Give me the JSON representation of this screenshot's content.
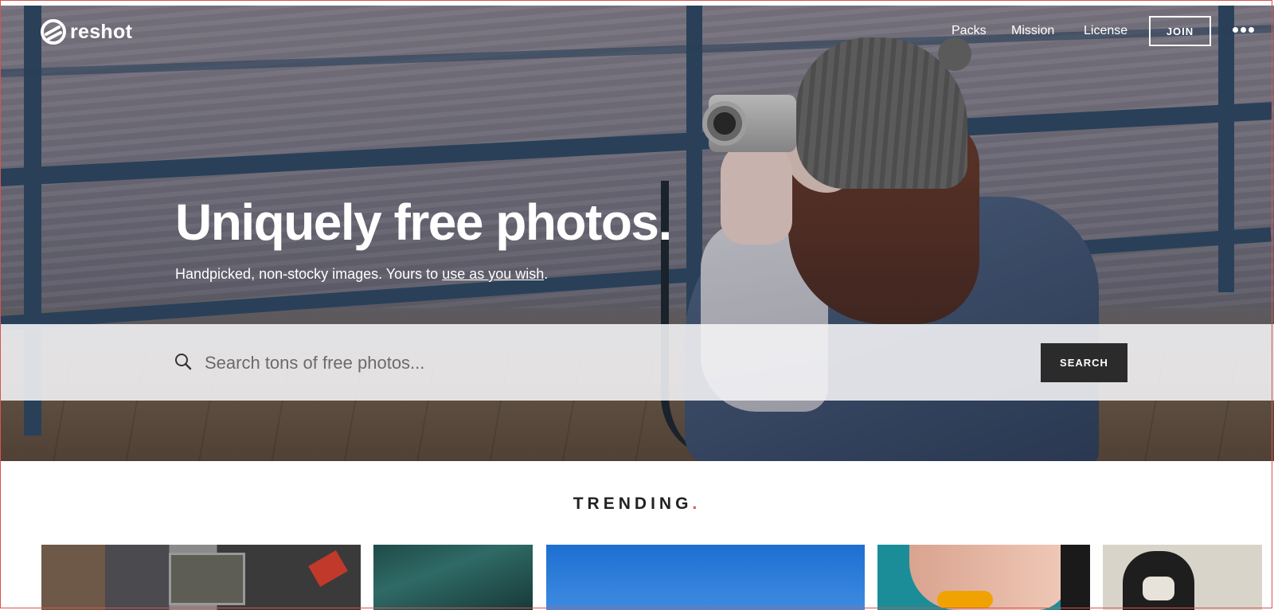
{
  "brand": {
    "name": "reshot"
  },
  "nav": {
    "items": [
      {
        "label": "Packs"
      },
      {
        "label": "Mission"
      },
      {
        "label": "License"
      }
    ],
    "join_label": "JOIN",
    "more_icon": "more-dots-icon"
  },
  "hero": {
    "headline": "Uniquely free photos.",
    "subline_prefix": "Handpicked, non-stocky images. Yours to ",
    "subline_link": "use as you wish",
    "subline_suffix": "."
  },
  "search": {
    "placeholder": "Search tons of free photos...",
    "button_label": "SEARCH",
    "icon": "search-icon"
  },
  "trending": {
    "title": "TRENDING",
    "accent_dot": ".",
    "accent_color": "#d9534f"
  },
  "colors": {
    "search_button_bg": "#2b2b2b",
    "text_on_hero": "#ffffff"
  }
}
